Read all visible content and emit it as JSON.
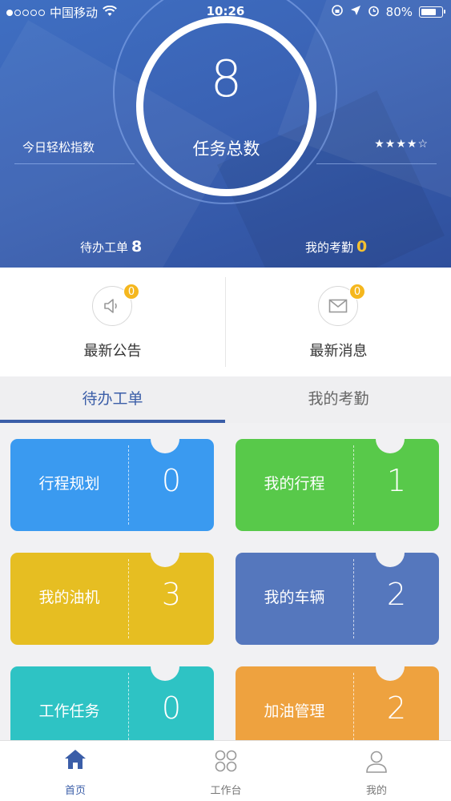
{
  "statusbar": {
    "carrier": "中国移动",
    "time": "10:26",
    "battery": "80%",
    "battery_level": 0.8,
    "icons": [
      "wifi-icon",
      "lock-rotation-icon",
      "location-icon",
      "alarm-icon",
      "battery-icon"
    ]
  },
  "hero": {
    "total_tasks": "8",
    "total_label": "任务总数",
    "ease_label": "今日轻松指数",
    "stars": "★★★★☆",
    "rating": 4.5,
    "pending_label": "待办工单",
    "pending_count": "8",
    "attendance_label": "我的考勤",
    "attendance_count": "0"
  },
  "notices": [
    {
      "label": "最新公告",
      "badge": "0",
      "icon": "speaker-icon"
    },
    {
      "label": "最新消息",
      "badge": "0",
      "icon": "envelope-icon"
    }
  ],
  "tabs": [
    {
      "label": "待办工单",
      "active": true
    },
    {
      "label": "我的考勤",
      "active": false
    }
  ],
  "cards": [
    {
      "title": "行程规划",
      "count": "0",
      "color": "#3a9af0"
    },
    {
      "title": "我的行程",
      "count": "1",
      "color": "#58c94a"
    },
    {
      "title": "我的油机",
      "count": "3",
      "color": "#e6be22"
    },
    {
      "title": "我的车辆",
      "count": "2",
      "color": "#5577bd"
    },
    {
      "title": "工作任务",
      "count": "0",
      "color": "#2ec3c4"
    },
    {
      "title": "加油管理",
      "count": "2",
      "color": "#eea23f"
    }
  ],
  "nav": [
    {
      "label": "首页",
      "icon": "home-icon",
      "active": true
    },
    {
      "label": "工作台",
      "icon": "grid-icon",
      "active": false
    },
    {
      "label": "我的",
      "icon": "user-icon",
      "active": false
    }
  ],
  "colors": {
    "accent": "#3b5ea8",
    "badge": "#f5b71e",
    "hero_bg": "#3a62b4"
  }
}
